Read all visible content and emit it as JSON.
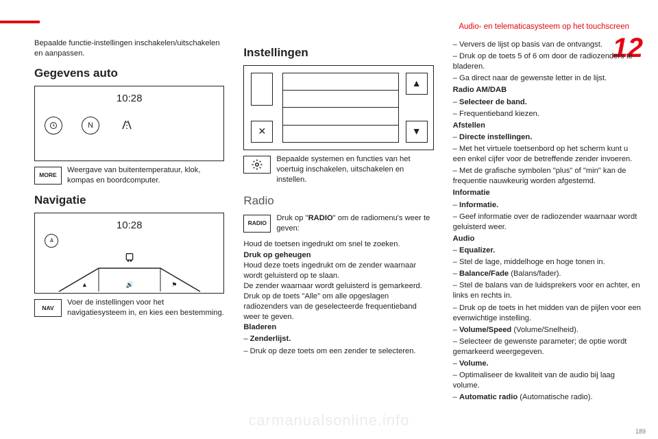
{
  "header": {
    "section_title": "Audio- en telematicasysteem op het touchscreen",
    "chapter_number": "12",
    "page_footer_number": "189",
    "watermark": "carmanualsonline.info"
  },
  "col1": {
    "intro": "Bepaalde functie-instellingen inschakelen/uitschakelen en aanpassen.",
    "h_gegevens": "Gegevens auto",
    "fig_time": "10:28",
    "icon_more": "MORE",
    "desc_more": "Weergave van buitentemperatuur, klok, kompas en boordcomputer.",
    "h_nav": "Navigatie",
    "fig_nav_time": "10:28",
    "icon_nav": "NAV",
    "desc_nav": "Voer de instellingen voor het navigatiesysteem in, en kies een bestemming."
  },
  "col2": {
    "h_instellingen": "Instellingen",
    "close_symbol": "✕",
    "up_symbol": "▲",
    "down_symbol": "▼",
    "desc_settings": "Bepaalde systemen en functies van het voertuig inschakelen, uitschakelen en instellen.",
    "h_radio": "Radio",
    "icon_radio": "RADIO",
    "desc_radio_a": "Druk op \"",
    "desc_radio_b": "RADIO",
    "desc_radio_c": "\" om de radiomenu's weer te geven:",
    "p_houd": "Houd de toetsen ingedrukt om snel te zoeken.",
    "b_druk": "Druk op geheugen",
    "p_houd2": "Houd deze toets ingedrukt om de zender waarnaar wordt geluisterd op te slaan.",
    "p_zender": "De zender waarnaar wordt geluisterd is gemarkeerd.",
    "p_alle": "Druk op de toets \"Alle\" om alle opgeslagen radiozenders van de geselecteerde frequentieband weer te geven.",
    "b_bladeren": "Bladeren",
    "li_zenderlijst": "Zenderlijst.",
    "li_drukop": "Druk op deze toets om een zender te selecteren."
  },
  "col3": {
    "li_ververs": "Ververs de lijst op basis van de ontvangst.",
    "li_drukop56": "Druk op de toets 5 of 6 om door de radiozenders te bladeren.",
    "li_gadirect": "Ga direct naar de gewenste letter in de lijst.",
    "b_radio_amdab": "Radio AM/DAB",
    "li_selecteer": "Selecteer de band.",
    "li_freq": "Frequentieband kiezen.",
    "b_afstellen": "Afstellen",
    "li_directe": "Directe instellingen.",
    "li_virtuele": "Met het virtuele toetsenbord op het scherm kunt u een enkel cijfer voor de betreffende zender invoeren.",
    "li_grafische": "Met de grafische symbolen \"plus\" of \"min\" kan de frequentie nauwkeurig worden afgestemd.",
    "b_informatie": "Informatie",
    "li_informatie": "Informatie.",
    "li_geef": "Geef informatie over de radiozender waarnaar wordt geluisterd weer.",
    "b_audio": "Audio",
    "li_equalizer": "Equalizer.",
    "li_stel_lage": "Stel de lage, middelhoge en hoge tonen in.",
    "li_balance": "Balance/Fade",
    "li_balance_paren": " (Balans/fader).",
    "li_stel_balans": "Stel de balans van de luidsprekers voor en achter, en links en rechts in.",
    "li_drukop_mid": "Druk op de toets in het midden van de pijlen voor een evenwichtige instelling.",
    "li_volspeed": "Volume/Speed",
    "li_volspeed_paren": " (Volume/Snelheid).",
    "li_selecteer_param": "Selecteer de gewenste parameter; de optie wordt gemarkeerd weergegeven.",
    "li_volume": "Volume.",
    "li_optimaliseer": "Optimaliseer de kwaliteit van de audio bij laag volume.",
    "li_autoradio": "Automatic radio",
    "li_autoradio_paren": " (Automatische radio)."
  }
}
